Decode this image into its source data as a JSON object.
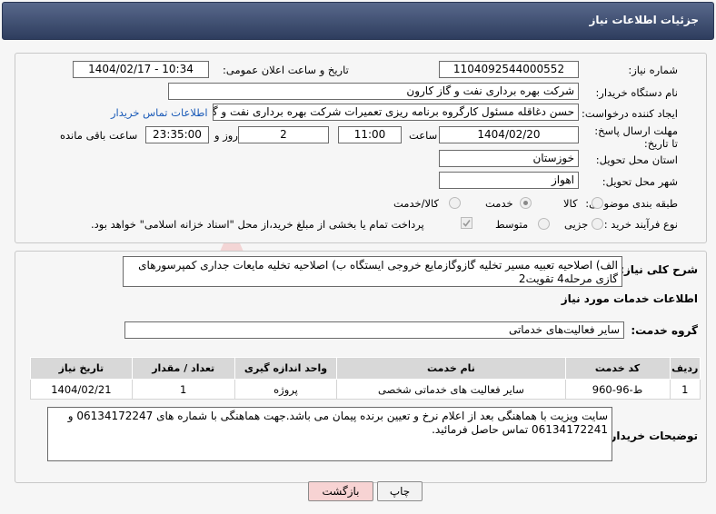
{
  "header": {
    "title": "جزئیات اطلاعات نیاز"
  },
  "form": {
    "need_number": {
      "label": "شماره نیاز:",
      "value": "1104092544000552"
    },
    "announce_datetime": {
      "label": "تاریخ و ساعت اعلان عمومی:",
      "value": "1404/02/17 - 10:34"
    },
    "buyer_org": {
      "label": "نام دستگاه خریدار:",
      "value": "شرکت بهره برداری نفت و گاز کارون"
    },
    "creator": {
      "label": "ایجاد کننده درخواست:",
      "value": "حسن دغاقله مسئول کارگروه برنامه ریزی تعمیرات شرکت بهره برداری نفت و گاز",
      "contact_link": "اطلاعات تماس خریدار"
    },
    "deadline": {
      "label": "مهلت ارسال پاسخ: تا تاریخ:",
      "date": "1404/02/20",
      "time_label": "ساعت",
      "time": "11:00",
      "days": "2",
      "days_label": "روز و",
      "remaining": "23:35:00",
      "remaining_label": "ساعت باقی مانده"
    },
    "province": {
      "label": "استان محل تحویل:",
      "value": "خوزستان"
    },
    "city": {
      "label": "شهر محل تحویل:",
      "value": "اهواز"
    },
    "category": {
      "label": "طبقه بندی موضوعی:",
      "options": [
        "کالا",
        "خدمت",
        "کالا/خدمت"
      ],
      "selected": "خدمت"
    },
    "process": {
      "label": "نوع فرآیند خرید :",
      "options": [
        "جزیی",
        "متوسط"
      ],
      "note": "پرداخت تمام یا بخشی از مبلغ خرید،از محل \"اسناد خزانه اسلامی\" خواهد بود."
    }
  },
  "summary": {
    "label": "شرح کلی نیاز:",
    "text": "الف) اصلاحیه تعبیه مسیر تخلیه گازوگازمایع خروجی ایستگاه  ب) اصلاحیه تخلیه مایعات جداری کمپرسورهای گازی مرحله4 تقویت2"
  },
  "services": {
    "section_title": "اطلاعات خدمات مورد نیاز",
    "group_label": "گروه خدمت:",
    "group_value": "سایر فعالیت‌های خدماتی",
    "columns": [
      "ردیف",
      "کد خدمت",
      "نام خدمت",
      "واحد اندازه گیری",
      "تعداد / مقدار",
      "تاریخ نیاز"
    ],
    "rows": [
      [
        "1",
        "ط-96-960",
        "سایر فعالیت های خدماتی شخصی",
        "پروژه",
        "1",
        "1404/02/21"
      ]
    ]
  },
  "buyer_notes": {
    "label": "توضیحات خریدار:",
    "text": "سایت ویزیت با هماهنگی بعد از اعلام نرخ و تعیین برنده پیمان می باشد.جهت هماهنگی با شماره های  06134172247 و 06134172241 تماس حاصل فرمائید."
  },
  "buttons": {
    "print": "چاپ",
    "back": "بازگشت"
  },
  "watermark": {
    "text": "AriaTender.neT"
  },
  "colors": {
    "header": "#3e4c6e",
    "link": "#1b5bb8",
    "back_button": "#f7d3d3",
    "watermark": "#f2d4d4"
  }
}
